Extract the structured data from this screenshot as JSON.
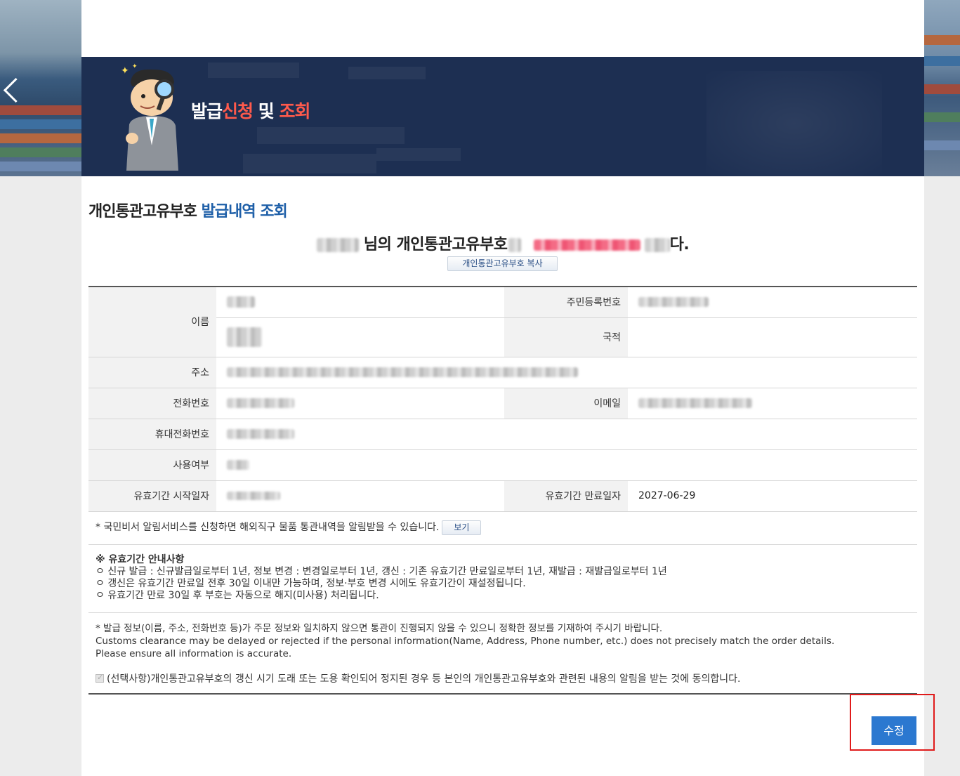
{
  "banner": {
    "title_part1": "발급",
    "title_part2": "신청",
    "title_part3": " 및 ",
    "title_part4": "조회"
  },
  "section": {
    "title_part1": "개인통관고유부호 ",
    "title_part2": "발급내역 조회"
  },
  "owner": {
    "mid_text": "님의 개인통관고유부호",
    "end_text": "다.",
    "copy_button": "개인통관고유부호 복사"
  },
  "fields": {
    "name_label": "이름",
    "rrn_label": "주민등록번호",
    "nationality_label": "국적",
    "address_label": "주소",
    "phone_label": "전화번호",
    "email_label": "이메일",
    "mobile_label": "휴대전화번호",
    "use_label": "사용여부",
    "start_label": "유효기간 시작일자",
    "end_label": "유효기간 만료일자",
    "end_value": "2027-06-29"
  },
  "notice": {
    "text": "* 국민비서 알림서비스를 신청하면 해외직구 물품 통관내역을 알림받을 수 있습니다.",
    "view_button": "보기"
  },
  "guide": {
    "title": "※ 유효기간 안내사항",
    "line1": "ㅇ 신규 발급 : 신규발급일로부터 1년, 정보 변경 : 변경일로부터 1년, 갱신 : 기존 유효기간 만료일로부터 1년, 재발급 : 재발급일로부터 1년",
    "line2": "ㅇ 갱신은 유효기간 만료일 전후 30일 이내만 가능하며, 정보·부호 변경 시에도 유효기간이 재설정됩니다.",
    "line3": "ㅇ 유효기간 만료 30일 후 부호는 자동으로 해지(미사용) 처리됩니다."
  },
  "warning": {
    "ko": "* 발급 정보(이름, 주소, 전화번호 등)가 주문 정보와 일치하지 않으면 통관이 진행되지 않을 수 있으니 정확한 정보를 기재하여 주시기 바랍니다.",
    "en1": "Customs clearance may be delayed or rejected if the personal information(Name, Address, Phone number, etc.) does not precisely match the order details.",
    "en2": "Please ensure all information is accurate."
  },
  "consent": {
    "text": "(선택사항)개인통관고유부호의 갱신 시기 도래 또는 도용 확인되어 정지된 경우 등 본인의 개인통관고유부호와 관련된 내용의 알림을 받는 것에 동의합니다.",
    "checked": true
  },
  "actions": {
    "edit_button": "수정"
  },
  "colors": {
    "banner_bg": "#1d2f52",
    "accent_blue": "#1e5fa8",
    "accent_red": "#ff5a4c",
    "button_blue": "#2b78d0",
    "highlight_red": "#e01b1b"
  }
}
